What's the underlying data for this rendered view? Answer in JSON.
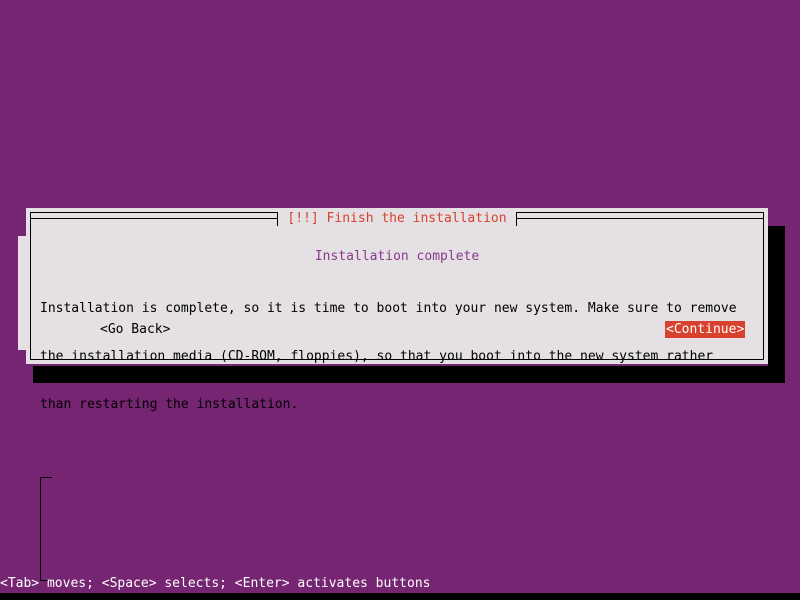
{
  "screen": {
    "background_color": "#762572",
    "bottom_strip_color": "#000000"
  },
  "dialog": {
    "title": "[!!] Finish the installation",
    "title_color": "#d8412d",
    "panel_color": "#e4e0e4",
    "border_color": "#000000",
    "heading": "Installation complete",
    "heading_color": "#883a8d",
    "paragraph_lines": [
      "Installation is complete, so it is time to boot into your new system. Make sure to remove",
      "the installation media (CD-ROM, floppies), so that you boot into the new system rather",
      "than restarting the installation."
    ],
    "buttons": {
      "go_back": {
        "label": "<Go Back>",
        "selected": false,
        "text_color": "#000000"
      },
      "continue": {
        "label": "<Continue>",
        "selected": true,
        "text_color": "#ffffff",
        "highlight_color": "#d8412d"
      }
    }
  },
  "status_bar": {
    "text": "<Tab> moves; <Space> selects; <Enter> activates buttons",
    "text_color": "#ffffff"
  }
}
